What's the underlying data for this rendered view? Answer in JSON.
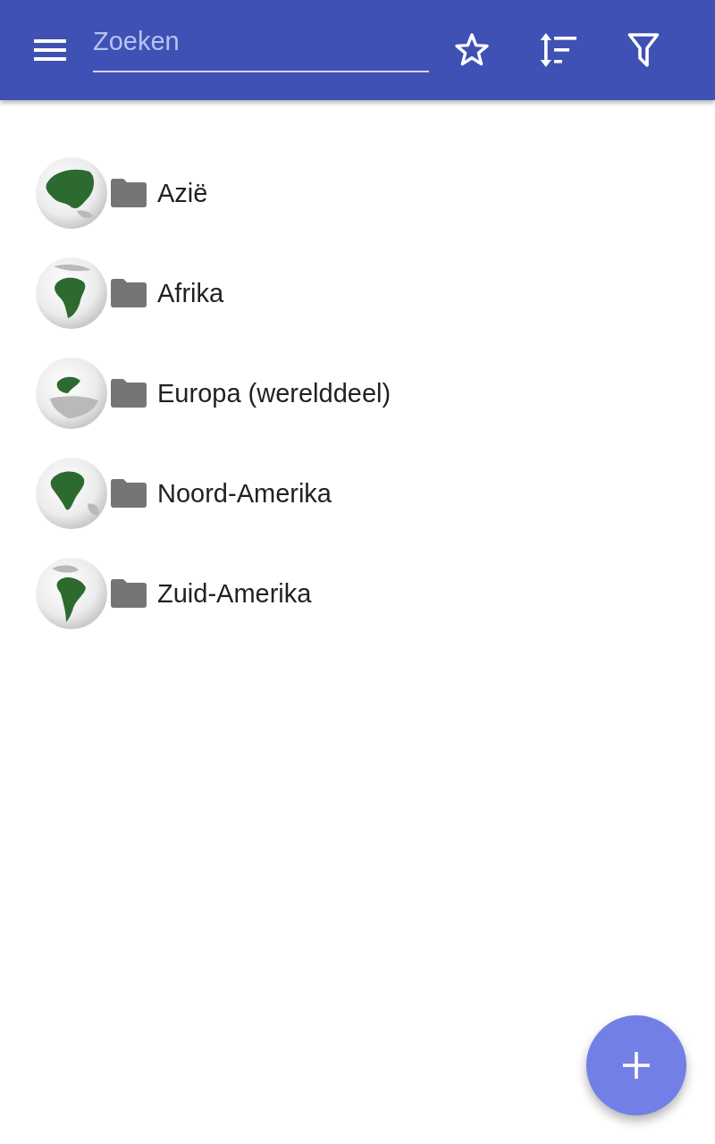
{
  "app_bar": {
    "search": {
      "placeholder": "Zoeken"
    }
  },
  "folders": [
    {
      "label": "Azië"
    },
    {
      "label": "Afrika"
    },
    {
      "label": "Europa (werelddeel)"
    },
    {
      "label": "Noord-Amerika"
    },
    {
      "label": "Zuid-Amerika"
    }
  ]
}
